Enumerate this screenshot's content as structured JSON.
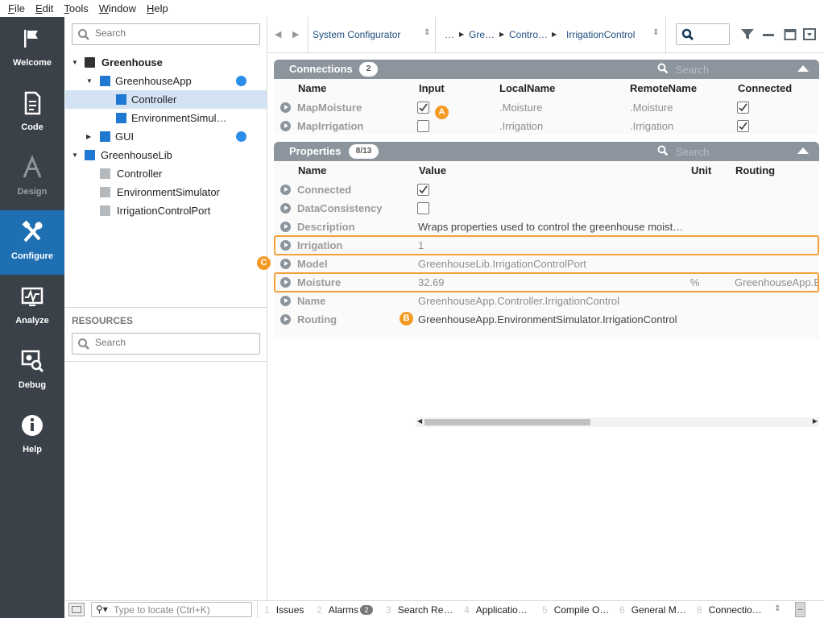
{
  "menu": [
    {
      "label": "File",
      "key": "F",
      "rest": "ile"
    },
    {
      "label": "Edit",
      "key": "E",
      "rest": "dit"
    },
    {
      "label": "Tools",
      "key": "T",
      "rest": "ools"
    },
    {
      "label": "Window",
      "key": "W",
      "rest": "indow"
    },
    {
      "label": "Help",
      "key": "H",
      "rest": "elp"
    }
  ],
  "nav": [
    {
      "label": "Welcome",
      "icon": "flag-icon"
    },
    {
      "label": "Code",
      "icon": "document-icon"
    },
    {
      "label": "Design",
      "icon": "design-icon"
    },
    {
      "label": "Configure",
      "icon": "tools-icon",
      "active": true
    },
    {
      "label": "Analyze",
      "icon": "chart-icon"
    },
    {
      "label": "Debug",
      "icon": "debug-icon"
    },
    {
      "label": "Help",
      "icon": "info-icon"
    }
  ],
  "tree": {
    "search_placeholder": "Search",
    "nodes": [
      {
        "label": "Greenhouse"
      },
      {
        "label": "GreenhouseApp"
      },
      {
        "label": "Controller"
      },
      {
        "label": "EnvironmentSimul…"
      },
      {
        "label": "GUI"
      },
      {
        "label": "GreenhouseLib"
      },
      {
        "label": "Controller"
      },
      {
        "label": "EnvironmentSimulator"
      },
      {
        "label": "IrrigationControlPort"
      }
    ],
    "resources_label": "RESOURCES",
    "resources_placeholder": "Search"
  },
  "toolbar": {
    "configurator": "System Configurator",
    "crumbs": [
      "…",
      "Gre…",
      "Contro…",
      "IrrigationControl"
    ]
  },
  "connections": {
    "title": "Connections",
    "count": "2",
    "search_placeholder": "Search",
    "columns": [
      "Name",
      "Input",
      "LocalName",
      "RemoteName",
      "Connected"
    ],
    "rows": [
      {
        "name": "MapMoisture",
        "input": true,
        "local": ".Moisture",
        "remote": ".Moisture",
        "connected": true
      },
      {
        "name": "MapIrrigation",
        "input": false,
        "local": ".Irrigation",
        "remote": ".Irrigation",
        "connected": true
      }
    ]
  },
  "properties": {
    "title": "Properties",
    "count": "8/13",
    "search_placeholder": "Search",
    "columns": [
      "Name",
      "Value",
      "Unit",
      "Routing"
    ],
    "rows": [
      {
        "name": "Connected",
        "type": "check",
        "checked": true
      },
      {
        "name": "DataConsistency",
        "type": "check",
        "checked": false
      },
      {
        "name": "Description",
        "value": "Wraps properties used to control the greenhouse moist…",
        "dark": true
      },
      {
        "name": "Irrigation",
        "value": "1",
        "highlight": true
      },
      {
        "name": "Model",
        "value": "GreenhouseLib.IrrigationControlPort"
      },
      {
        "name": "Moisture",
        "value": "32.69",
        "unit": "%",
        "routing": "GreenhouseApp.E",
        "highlight": true
      },
      {
        "name": "Name",
        "value": "GreenhouseApp.Controller.IrrigationControl"
      },
      {
        "name": "Routing",
        "value": "GreenhouseApp.EnvironmentSimulator.IrrigationControl",
        "dark": true
      }
    ]
  },
  "markers": {
    "a": "A",
    "b": "B",
    "c": "C"
  },
  "statusbar": {
    "locate_placeholder": "Type to locate (Ctrl+K)",
    "tabs": [
      {
        "num": "1",
        "label": "Issues"
      },
      {
        "num": "2",
        "label": "Alarms",
        "badge": "2"
      },
      {
        "num": "3",
        "label": "Search Re…"
      },
      {
        "num": "4",
        "label": "Applicatio…"
      },
      {
        "num": "5",
        "label": "Compile O…"
      },
      {
        "num": "6",
        "label": "General M…"
      },
      {
        "num": "8",
        "label": "Connectio…"
      }
    ]
  },
  "colors": {
    "accent": "#1f6fb3",
    "highlight": "#f5a03a",
    "sidebar": "#3a4148",
    "panel_header": "#8c959e"
  }
}
